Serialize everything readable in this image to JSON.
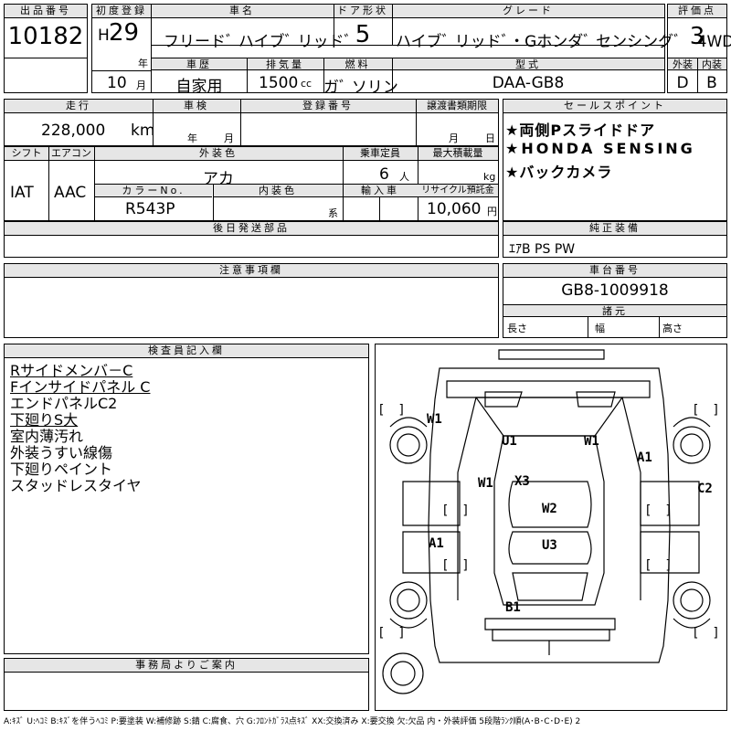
{
  "sheet": {
    "lot_label": "出品番号",
    "lot_no": "10182",
    "first_reg_label": "初度登録",
    "era": "H",
    "year": "29",
    "year_unit": "年",
    "month": "10",
    "month_unit": "月",
    "model_label": "車名",
    "model": "フリードﾞ ハイブﾞ リッドﾞ",
    "doors_label": "ドア形状",
    "doors": "5",
    "grade_label": "グレード",
    "grade": "ハイブﾞ リッドﾞ・Gホンダﾞ センシングﾞ　4WD",
    "score_label": "評価点",
    "score": "3",
    "history_label": "車歴",
    "history": "自家用",
    "displacement_label": "排気量",
    "displacement": "1500",
    "displacement_unit": "cc",
    "fuel_label": "燃料",
    "fuel": "ガﾞ ソリン",
    "type_label": "型式",
    "type": "DAA-GB8",
    "exterior_label": "外装",
    "exterior": "D",
    "interior_label": "内装",
    "interior": "B"
  },
  "row2": {
    "mileage_label": "走行",
    "mileage": "228,000",
    "mileage_unit": "km",
    "inspection_label": "車検",
    "insp_year": "年",
    "insp_month": "月",
    "reg_label": "登録番号",
    "transfer_label": "譲渡書類期限",
    "transfer_month": "月",
    "transfer_day": "日",
    "sales_label": "セールスポイント",
    "sales_points": [
      "★両側Pスライドドア",
      "★HONDA SENSING",
      "★バックカメラ"
    ]
  },
  "row3": {
    "shift_label": "シフト",
    "shift": "IAT",
    "ac_label": "エアコン",
    "ac": "AAC",
    "color_label": "外装色",
    "color": "アカ",
    "capacity_label": "乗車定員",
    "capacity": "6",
    "capacity_unit": "人",
    "load_label": "最大積載量",
    "load_unit": "kg",
    "color_no_label": "カラーNo.",
    "color_no": "R543P",
    "interior_color_label": "内装色",
    "interior_color_unit": "系",
    "import_label": "輸入車",
    "recycle_label": "リサイクル預託金",
    "recycle": "10,060",
    "recycle_unit": "円"
  },
  "parts": {
    "label": "後日発送部品"
  },
  "equipment": {
    "label": "純正装備",
    "value": "ｴｱB PS PW"
  },
  "notes": {
    "label": "注意事項欄"
  },
  "chassis": {
    "label": "車台番号",
    "value": "GB8-1009918"
  },
  "dims": {
    "label": "諸元",
    "length": "長さ",
    "width": "幅",
    "height": "高さ"
  },
  "inspector": {
    "label": "検査員記入欄",
    "remarks": [
      "Rサイドメンバ－C",
      "Fインサイドパネル C",
      "エンドパネルC2",
      "下廻りS大",
      "室内薄汚れ",
      "外装うすい線傷",
      "下廻りペイント",
      "スタッドレスタイヤ"
    ]
  },
  "office": {
    "label": "事務局よりご案内"
  },
  "diagram": {
    "marks": [
      "W1",
      "U1",
      "W1",
      "A1",
      "W1",
      "X3",
      "C2",
      "W2",
      "A1",
      "U3",
      "B1"
    ],
    "bracket": "[　]"
  },
  "legend": "A:ｷｽﾞ U:ﾍｺﾐ B:ｷｽﾞを伴うﾍｺﾐ P:要塗装 W:補修跡 S:錆 C:腐食、穴 G:ﾌﾛﾝﾄｶﾞﾗｽ点ｷｽﾞ XX:交換済み X:要交換 欠:欠品 内・外装評価 5段階ﾗﾝｸ順(A･B･C･D･E) 2"
}
